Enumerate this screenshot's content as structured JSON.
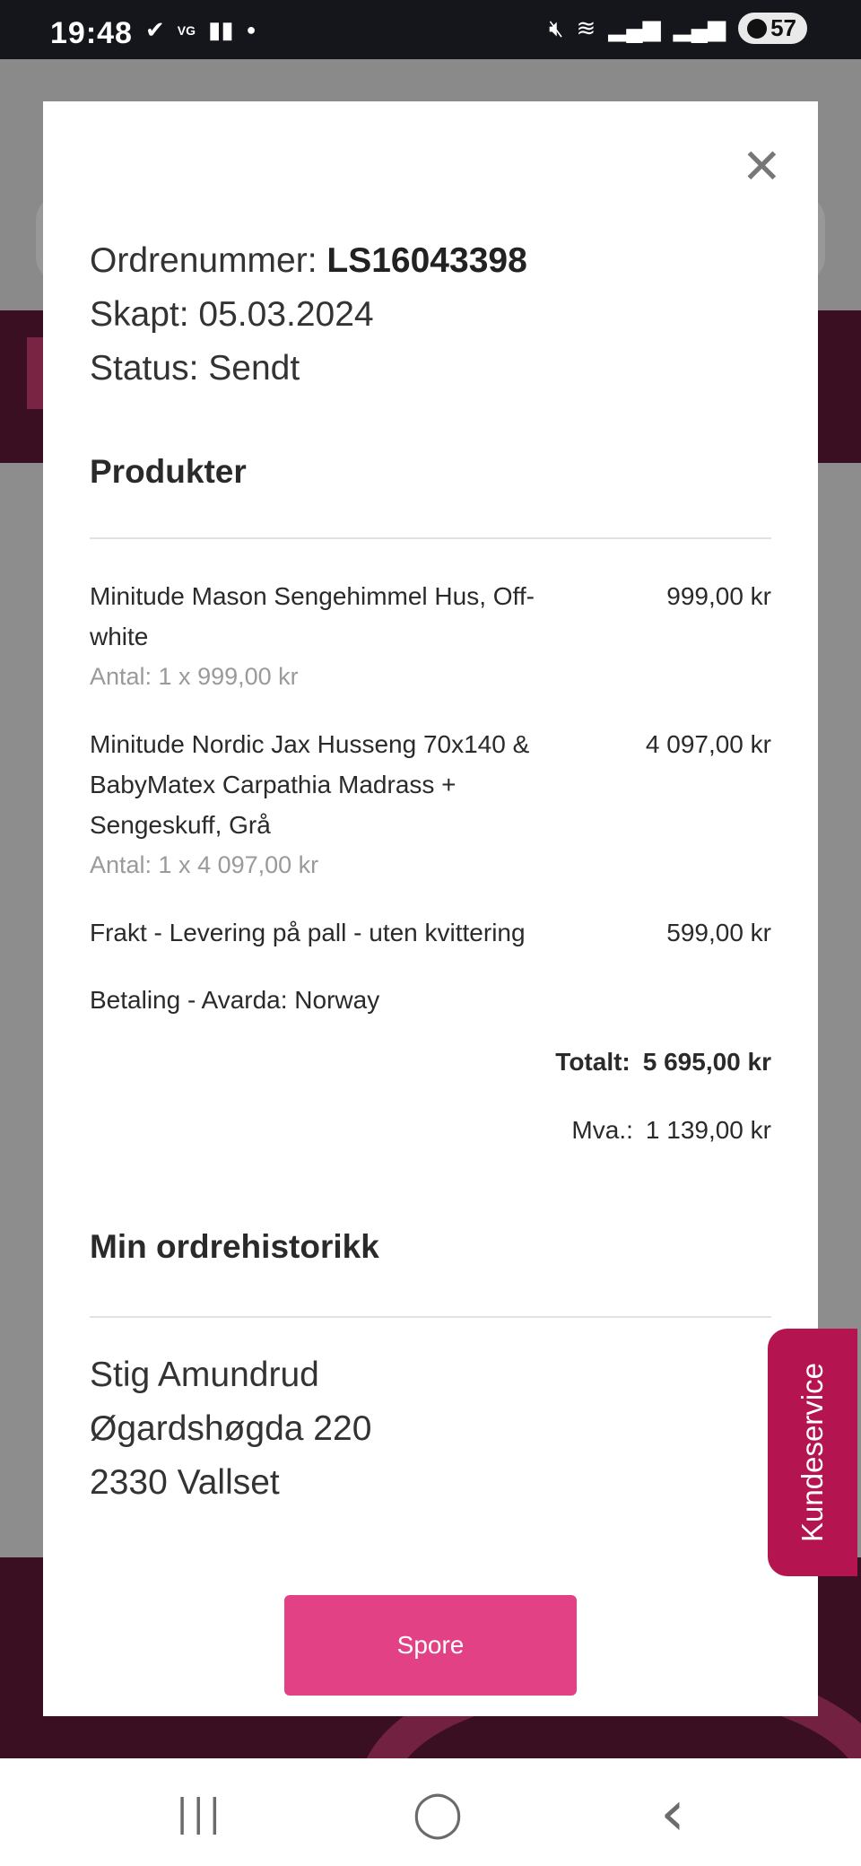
{
  "status_bar": {
    "time": "19:48",
    "notification_icons": [
      "check-icon",
      "vg-icon",
      "news-icon",
      "dot-icon"
    ],
    "vg_text": "VG",
    "battery": "57"
  },
  "modal": {
    "order_number_label": "Ordrenummer:",
    "order_number": "LS16043398",
    "created_label": "Skapt:",
    "created": "05.03.2024",
    "status_label": "Status:",
    "status": "Sendt",
    "products_title": "Produkter",
    "items": [
      {
        "name": "Minitude Mason Sengehimmel Hus, Off-white",
        "price": "999,00 kr",
        "qty": "Antal: 1 x 999,00 kr"
      },
      {
        "name": "Minitude Nordic Jax Husseng 70x140 & BabyMatex Carpathia Madrass + Sengeskuff, Grå",
        "price": "4 097,00 kr",
        "qty": "Antal: 1 x 4 097,00 kr"
      },
      {
        "name": "Frakt - Levering på pall - uten kvittering",
        "price": "599,00 kr"
      },
      {
        "name": "Betaling - Avarda: Norway"
      }
    ],
    "total_label": "Totalt:",
    "total": "5 695,00 kr",
    "vat_label": "Mva.:",
    "vat": "1 139,00 kr",
    "history_title": "Min ordrehistorikk",
    "address": {
      "name": "Stig Amundrud",
      "street": "Øgardshøgda 220",
      "city": "2330 Vallset"
    },
    "track_button": "Spore"
  },
  "kundeservice": "Kundeservice",
  "nav": {
    "recents": "|||",
    "home": "◯",
    "back": "‹"
  }
}
